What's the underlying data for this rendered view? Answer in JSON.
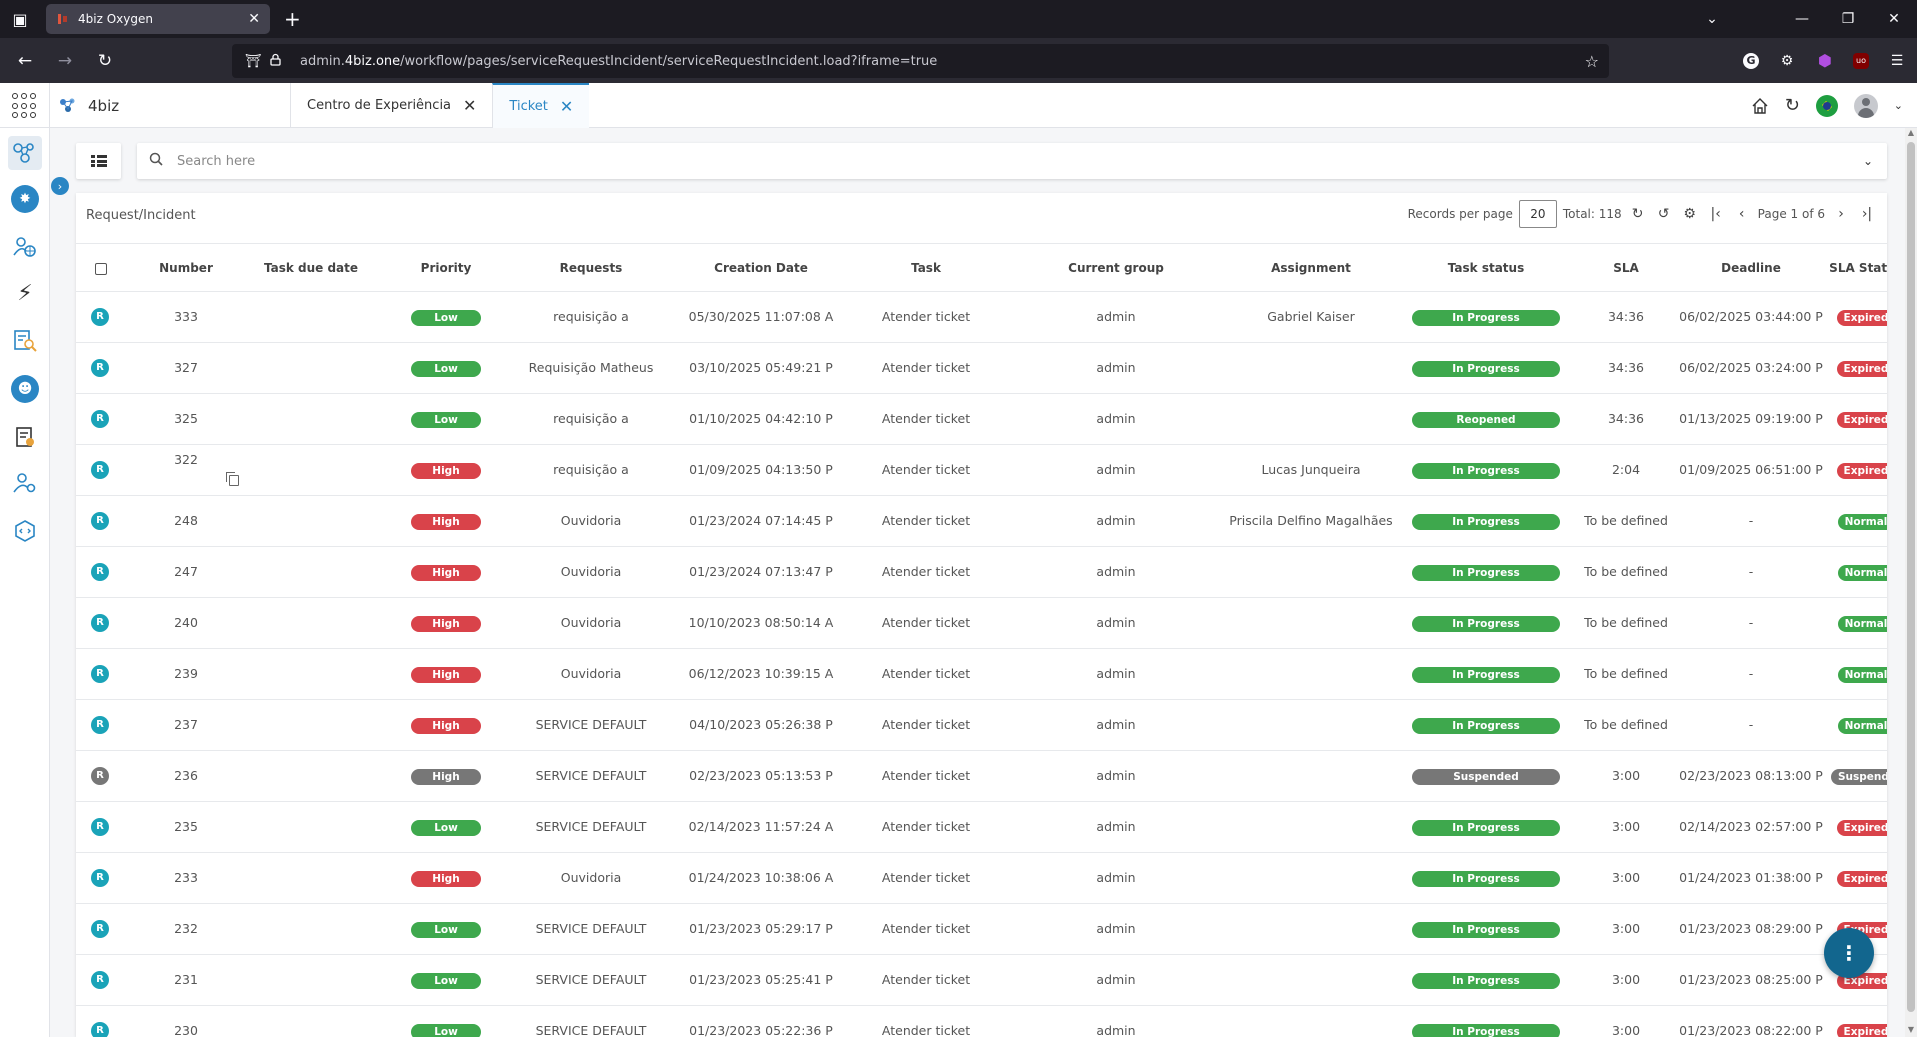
{
  "browser": {
    "tab_title": "4biz Oxygen",
    "url_prefix": "admin.",
    "url_domain": "4biz.one",
    "url_path": "/workflow/pages/serviceRequestIncident/serviceRequestIncident.load?iframe=true"
  },
  "app": {
    "brand": "4biz",
    "tabs": [
      {
        "label": "Centro de Experiência",
        "active": false
      },
      {
        "label": "Ticket",
        "active": true
      }
    ]
  },
  "search": {
    "placeholder": "Search here"
  },
  "list": {
    "title": "Request/Incident",
    "records_per_page_label": "Records per page",
    "records_per_page": "20",
    "total": "Total: 118",
    "page": "Page 1 of 6"
  },
  "columns": [
    "Number",
    "Task due date",
    "Priority",
    "Requests",
    "Creation Date",
    "Task",
    "Current group",
    "Assignment",
    "Task status",
    "SLA",
    "Deadline",
    "SLA Status"
  ],
  "rows": [
    {
      "badge": "R",
      "number": "333",
      "due": "",
      "priority": "Low",
      "request": "requisição a",
      "created": "05/30/2025 11:07:08 A",
      "task": "Atender ticket",
      "group": "admin",
      "assign": "Gabriel Kaiser",
      "status": "In Progress",
      "sla": "34:36",
      "deadline": "06/02/2025 03:44:00 P",
      "sla_status": "Expired"
    },
    {
      "badge": "R",
      "number": "327",
      "due": "",
      "priority": "Low",
      "request": "Requisição Matheus",
      "created": "03/10/2025 05:49:21 P",
      "task": "Atender ticket",
      "group": "admin",
      "assign": "",
      "status": "In Progress",
      "sla": "34:36",
      "deadline": "06/02/2025 03:24:00 P",
      "sla_status": "Expired"
    },
    {
      "badge": "R",
      "number": "325",
      "due": "",
      "priority": "Low",
      "request": "requisição a",
      "created": "01/10/2025 04:42:10 P",
      "task": "Atender ticket",
      "group": "admin",
      "assign": "",
      "status": "Reopened",
      "sla": "34:36",
      "deadline": "01/13/2025 09:19:00 P",
      "sla_status": "Expired"
    },
    {
      "badge": "R",
      "number": "322",
      "due": "",
      "priority": "High",
      "request": "requisição a",
      "created": "01/09/2025 04:13:50 P",
      "task": "Atender ticket",
      "group": "admin",
      "assign": "Lucas Junqueira",
      "status": "In Progress",
      "sla": "2:04",
      "deadline": "01/09/2025 06:51:00 P",
      "sla_status": "Expired"
    },
    {
      "badge": "R",
      "number": "248",
      "due": "",
      "priority": "High",
      "request": "Ouvidoria",
      "created": "01/23/2024 07:14:45 P",
      "task": "Atender ticket",
      "group": "admin",
      "assign": "Priscila Delfino Magalhães",
      "status": "In Progress",
      "sla": "To be defined",
      "deadline": "-",
      "sla_status": "Normal"
    },
    {
      "badge": "R",
      "number": "247",
      "due": "",
      "priority": "High",
      "request": "Ouvidoria",
      "created": "01/23/2024 07:13:47 P",
      "task": "Atender ticket",
      "group": "admin",
      "assign": "",
      "status": "In Progress",
      "sla": "To be defined",
      "deadline": "-",
      "sla_status": "Normal"
    },
    {
      "badge": "R",
      "number": "240",
      "due": "",
      "priority": "High",
      "request": "Ouvidoria",
      "created": "10/10/2023 08:50:14 A",
      "task": "Atender ticket",
      "group": "admin",
      "assign": "",
      "status": "In Progress",
      "sla": "To be defined",
      "deadline": "-",
      "sla_status": "Normal"
    },
    {
      "badge": "R",
      "number": "239",
      "due": "",
      "priority": "High",
      "request": "Ouvidoria",
      "created": "06/12/2023 10:39:15 A",
      "task": "Atender ticket",
      "group": "admin",
      "assign": "",
      "status": "In Progress",
      "sla": "To be defined",
      "deadline": "-",
      "sla_status": "Normal"
    },
    {
      "badge": "R",
      "number": "237",
      "due": "",
      "priority": "High",
      "request": "SERVICE DEFAULT",
      "created": "04/10/2023 05:26:38 P",
      "task": "Atender ticket",
      "group": "admin",
      "assign": "",
      "status": "In Progress",
      "sla": "To be defined",
      "deadline": "-",
      "sla_status": "Normal"
    },
    {
      "badge": "R",
      "number": "236",
      "due": "",
      "priority": "High",
      "request": "SERVICE DEFAULT",
      "created": "02/23/2023 05:13:53 P",
      "task": "Atender ticket",
      "group": "admin",
      "assign": "",
      "status": "Suspended",
      "sla": "3:00",
      "deadline": "02/23/2023 08:13:00 P",
      "sla_status": "Suspended"
    },
    {
      "badge": "R",
      "number": "235",
      "due": "",
      "priority": "Low",
      "request": "SERVICE DEFAULT",
      "created": "02/14/2023 11:57:24 A",
      "task": "Atender ticket",
      "group": "admin",
      "assign": "",
      "status": "In Progress",
      "sla": "3:00",
      "deadline": "02/14/2023 02:57:00 P",
      "sla_status": "Expired"
    },
    {
      "badge": "R",
      "number": "233",
      "due": "",
      "priority": "High",
      "request": "Ouvidoria",
      "created": "01/24/2023 10:38:06 A",
      "task": "Atender ticket",
      "group": "admin",
      "assign": "",
      "status": "In Progress",
      "sla": "3:00",
      "deadline": "01/24/2023 01:38:00 P",
      "sla_status": "Expired"
    },
    {
      "badge": "R",
      "number": "232",
      "due": "",
      "priority": "Low",
      "request": "SERVICE DEFAULT",
      "created": "01/23/2023 05:29:17 P",
      "task": "Atender ticket",
      "group": "admin",
      "assign": "",
      "status": "In Progress",
      "sla": "3:00",
      "deadline": "01/23/2023 08:29:00 P",
      "sla_status": "Expired"
    },
    {
      "badge": "R",
      "number": "231",
      "due": "",
      "priority": "Low",
      "request": "SERVICE DEFAULT",
      "created": "01/23/2023 05:25:41 P",
      "task": "Atender ticket",
      "group": "admin",
      "assign": "",
      "status": "In Progress",
      "sla": "3:00",
      "deadline": "01/23/2023 08:25:00 P",
      "sla_status": "Expired"
    },
    {
      "badge": "R",
      "number": "230",
      "due": "",
      "priority": "Low",
      "request": "SERVICE DEFAULT",
      "created": "01/23/2023 05:22:36 P",
      "task": "Atender ticket",
      "group": "admin",
      "assign": "",
      "status": "In Progress",
      "sla": "3:00",
      "deadline": "01/23/2023 08:22:00 P",
      "sla_status": "Expired"
    }
  ]
}
